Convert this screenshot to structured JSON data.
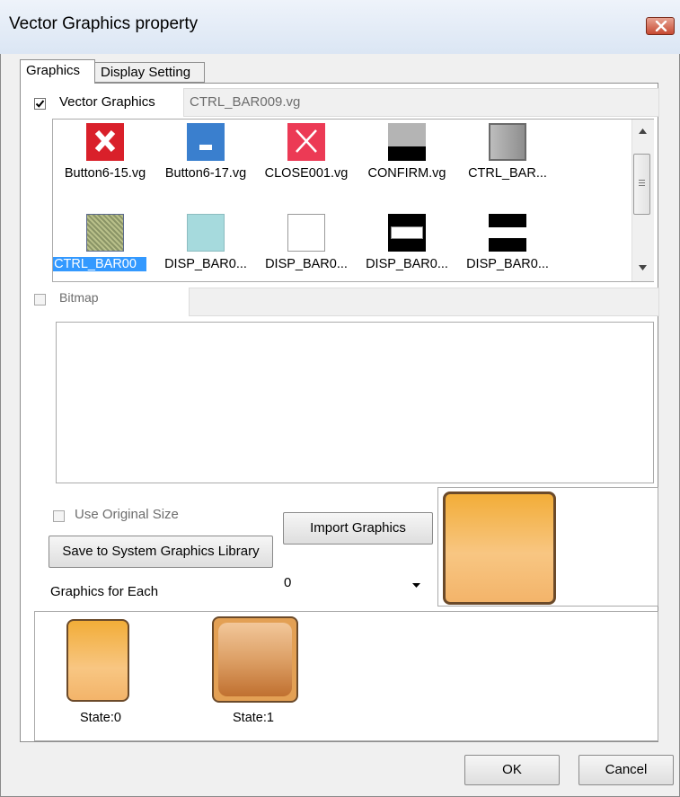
{
  "window": {
    "title": "Vector Graphics property"
  },
  "tabs": [
    {
      "label": "Graphics",
      "active": true
    },
    {
      "label": "Display Setting",
      "active": false
    }
  ],
  "vector_graphics": {
    "label": "Vector Graphics",
    "checked": true,
    "file": "CTRL_BAR009.vg"
  },
  "gallery": {
    "items": [
      {
        "caption": "Button6-15.vg",
        "icon": "red-x-icon"
      },
      {
        "caption": "Button6-17.vg",
        "icon": "blue-minus-icon"
      },
      {
        "caption": "CLOSE001.vg",
        "icon": "pink-x-icon"
      },
      {
        "caption": "CONFIRM.vg",
        "icon": "gray-black-bar-icon"
      },
      {
        "caption": "CTRL_BAR...",
        "icon": "gray-square-icon"
      },
      {
        "caption": "CTRL_BAR00",
        "icon": "textured-square-icon",
        "selected": true
      },
      {
        "caption": "DISP_BAR0...",
        "icon": "light-cyan-square-icon"
      },
      {
        "caption": "DISP_BAR0...",
        "icon": "white-square-icon"
      },
      {
        "caption": "DISP_BAR0...",
        "icon": "black-white-bar-icon"
      },
      {
        "caption": "DISP_BAR0...",
        "icon": "black-white-stripe-icon"
      }
    ]
  },
  "bitmap": {
    "label": "Bitmap",
    "checked": false
  },
  "use_original_size": {
    "label": "Use Original Size",
    "checked": false
  },
  "buttons": {
    "import": "Import Graphics",
    "save_library": "Save to System Graphics Library",
    "ok": "OK",
    "cancel": "Cancel"
  },
  "graphics_for_each": {
    "label": "Graphics for Each",
    "value": "0"
  },
  "states": [
    {
      "caption": "State:0"
    },
    {
      "caption": "State:1"
    }
  ],
  "colors": {
    "selection": "#3399ff",
    "orange_light": "#f6c574",
    "orange_dark": "#c77a2e"
  }
}
